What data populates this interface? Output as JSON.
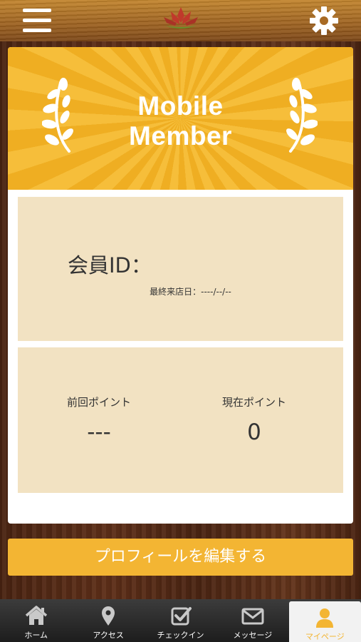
{
  "header": {
    "menu_icon": "hamburger-menu-icon",
    "logo": "lotus-logo",
    "settings_icon": "gear-icon"
  },
  "banner": {
    "title_line1": "Mobile",
    "title_line2": "Member",
    "decoration": "laurel-branch-icon"
  },
  "member": {
    "id_label": "会員ID：",
    "last_visit": "最終来店日：----/--/--"
  },
  "points": {
    "previous_label": "前回ポイント",
    "previous_value": "---",
    "current_label": "現在ポイント",
    "current_value": "0"
  },
  "edit_profile_button": "プロフィールを編集する",
  "tabs": [
    {
      "label": "ホーム",
      "icon": "home-icon"
    },
    {
      "label": "アクセス",
      "icon": "map-pin-icon"
    },
    {
      "label": "チェックイン",
      "icon": "checkbox-icon"
    },
    {
      "label": "メッセージ",
      "icon": "envelope-icon"
    },
    {
      "label": "マイページ",
      "icon": "user-icon",
      "active": true
    }
  ],
  "colors": {
    "accent": "#f3b533",
    "banner": "#f6be3a",
    "panel": "#f2e2c2",
    "tabbar": "#2b2b2b"
  }
}
